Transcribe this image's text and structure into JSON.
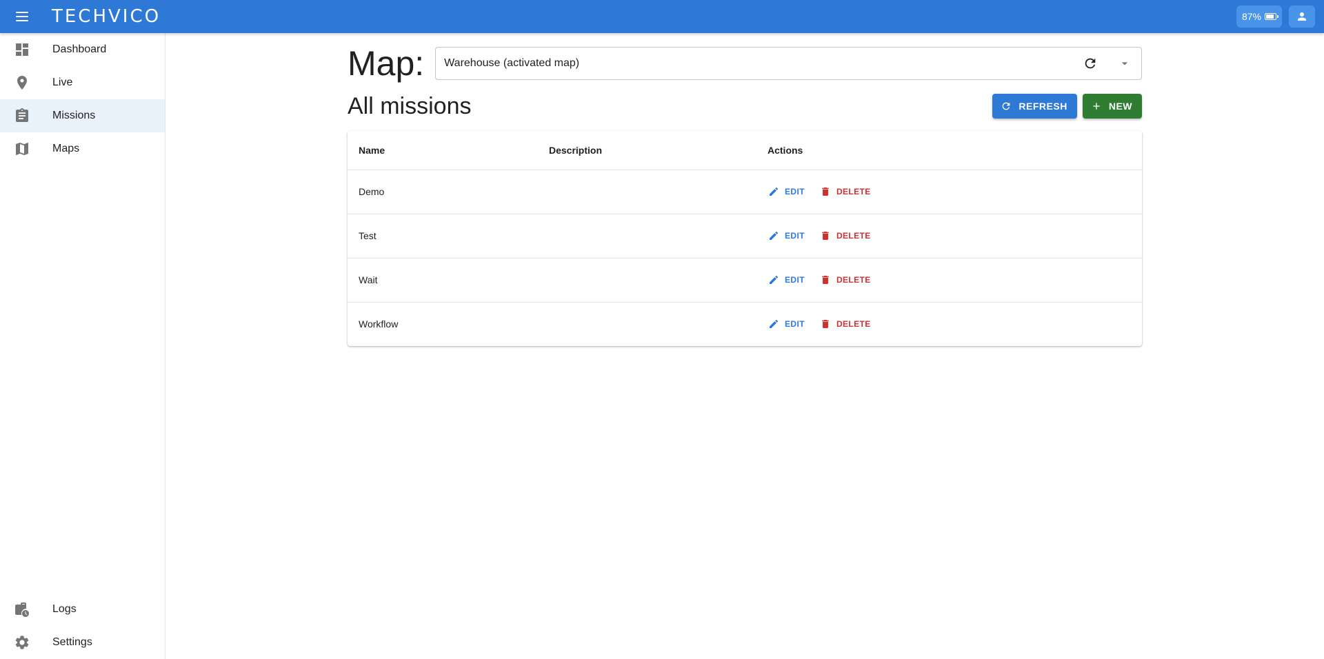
{
  "app": {
    "logo_text": "TECHVICO",
    "battery_label": "87%",
    "battery_level": 0.87
  },
  "sidebar": {
    "items": [
      {
        "label": "Dashboard",
        "icon": "dashboard-icon"
      },
      {
        "label": "Live",
        "icon": "location-pin-icon"
      },
      {
        "label": "Missions",
        "icon": "clipboard-icon",
        "active": true
      },
      {
        "label": "Maps",
        "icon": "map-icon"
      }
    ],
    "bottom_items": [
      {
        "label": "Logs",
        "icon": "logs-icon"
      },
      {
        "label": "Settings",
        "icon": "gear-icon"
      }
    ]
  },
  "main": {
    "map_label": "Map:",
    "map_select_value": "Warehouse (activated map)",
    "page_title": "All missions",
    "refresh_label": "REFRESH",
    "new_label": "NEW",
    "table": {
      "headers": [
        "Name",
        "Description",
        "Actions"
      ],
      "rows": [
        {
          "name": "Demo",
          "description": ""
        },
        {
          "name": "Test",
          "description": ""
        },
        {
          "name": "Wait",
          "description": ""
        },
        {
          "name": "Workflow",
          "description": ""
        }
      ],
      "edit_label": "EDIT",
      "delete_label": "DELETE"
    }
  },
  "colors": {
    "primary": "#2e78d6",
    "success": "#2f7d32",
    "danger": "#d32f2f",
    "nav_active_bg": "#e9f1fb"
  }
}
